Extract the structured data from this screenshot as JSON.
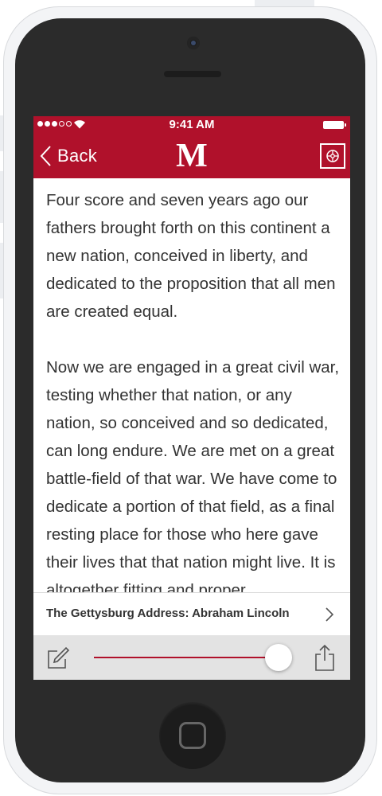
{
  "status_bar": {
    "time": "9:41 AM",
    "signal_bars_filled": 3,
    "signal_bars_total": 5
  },
  "nav": {
    "back_label": "Back",
    "logo_text": "M",
    "settings_icon": "settings-icon"
  },
  "article": {
    "paragraphs": [
      "Four score and seven years ago our fathers brought forth on this continent a new nation, conceived in liberty, and dedicated to the proposition that all men are created equal.",
      "Now we are engaged in a great civil war, testing whether that nation, or any nation, so conceived and so dedicated, can long endure. We are met on a great battle-field of that war. We have come to dedicate a portion of that field, as a final resting place for those who here gave their lives that that nation might live. It is altogether fitting and proper"
    ]
  },
  "title_bar": {
    "title": "The Gettysburg Address: Abraham Lincoln"
  },
  "toolbar": {
    "compose_icon": "compose-icon",
    "share_icon": "share-icon",
    "slider_value": 0.92
  },
  "colors": {
    "accent": "#b0112b",
    "toolbar_bg": "#e3e3e3",
    "phone_body": "#2b2b2b"
  }
}
